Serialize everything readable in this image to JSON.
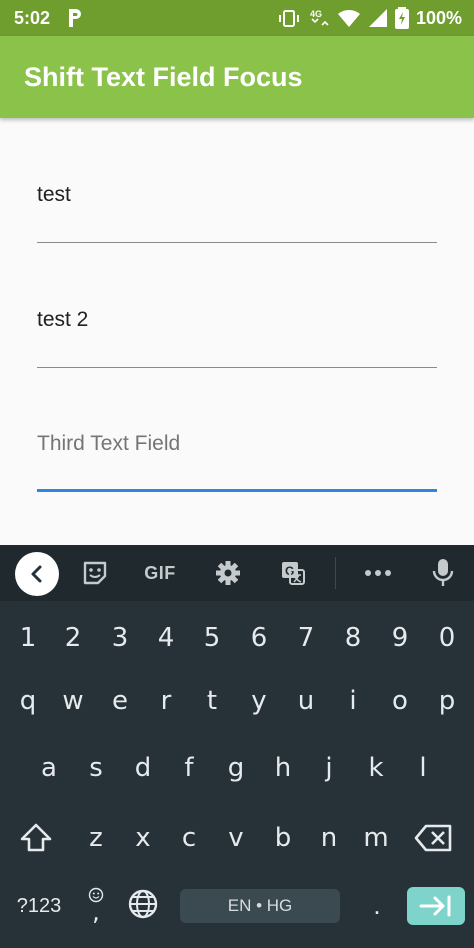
{
  "status_bar": {
    "time": "5:02",
    "network": "4G",
    "battery": "100%"
  },
  "app_bar": {
    "title": "Shift Text Field Focus"
  },
  "fields": [
    {
      "value": "test",
      "placeholder": ""
    },
    {
      "value": "test 2",
      "placeholder": ""
    },
    {
      "value": "",
      "placeholder": "Third Text Field"
    }
  ],
  "keyboard": {
    "toolbar_gif": "GIF",
    "number_row": [
      "1",
      "2",
      "3",
      "4",
      "5",
      "6",
      "7",
      "8",
      "9",
      "0"
    ],
    "row1": [
      "q",
      "w",
      "e",
      "r",
      "t",
      "y",
      "u",
      "i",
      "o",
      "p"
    ],
    "row2": [
      "a",
      "s",
      "d",
      "f",
      "g",
      "h",
      "j",
      "k",
      "l"
    ],
    "row3": [
      "z",
      "x",
      "c",
      "v",
      "b",
      "n",
      "m"
    ],
    "symbols_label": "?123",
    "space_label": "EN • HG",
    "period": ".",
    "comma": ","
  },
  "colors": {
    "status_bar": "#6f9e2e",
    "app_bar": "#8bc34a",
    "focus_underline": "#2e86de",
    "keyboard_bg": "#263238",
    "enter_key": "#7ed3cb"
  }
}
